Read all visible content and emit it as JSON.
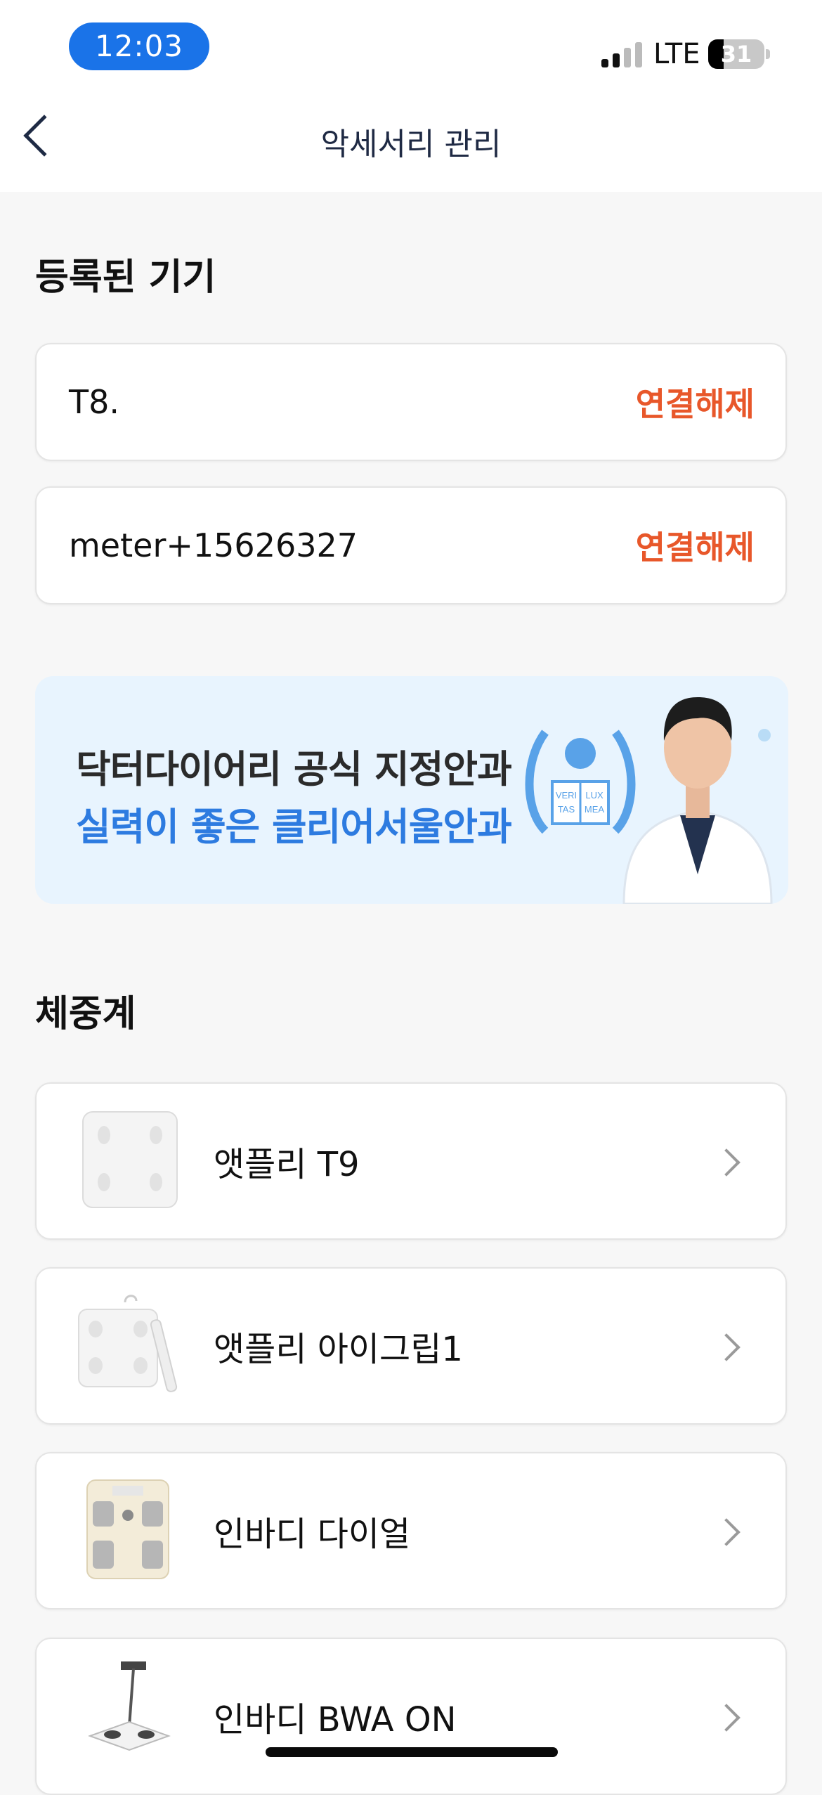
{
  "status_bar": {
    "time": "12:03",
    "network": "LTE",
    "battery": "31"
  },
  "header": {
    "title": "악세서리 관리"
  },
  "registered": {
    "title": "등록된 기기",
    "devices": [
      {
        "name": "T8.",
        "action": "연결해제"
      },
      {
        "name": "meter+15626327",
        "action": "연결해제"
      }
    ]
  },
  "banner": {
    "line1": "닥터다이어리 공식 지정안과",
    "line2": "실력이 좋은 클리어서울안과",
    "emblem_text": [
      "VERI",
      "TAS",
      "LUX",
      "MEA"
    ]
  },
  "scales": {
    "title": "체중계",
    "items": [
      {
        "name": "앳플리 T9"
      },
      {
        "name": "앳플리 아이그립1"
      },
      {
        "name": "인바디 다이얼"
      },
      {
        "name": "인바디 BWA ON"
      }
    ]
  },
  "colors": {
    "accent_blue": "#1a73e8",
    "disconnect": "#e8572a",
    "banner_bg": "#e8f4fe",
    "banner_blue": "#2d7be0"
  }
}
